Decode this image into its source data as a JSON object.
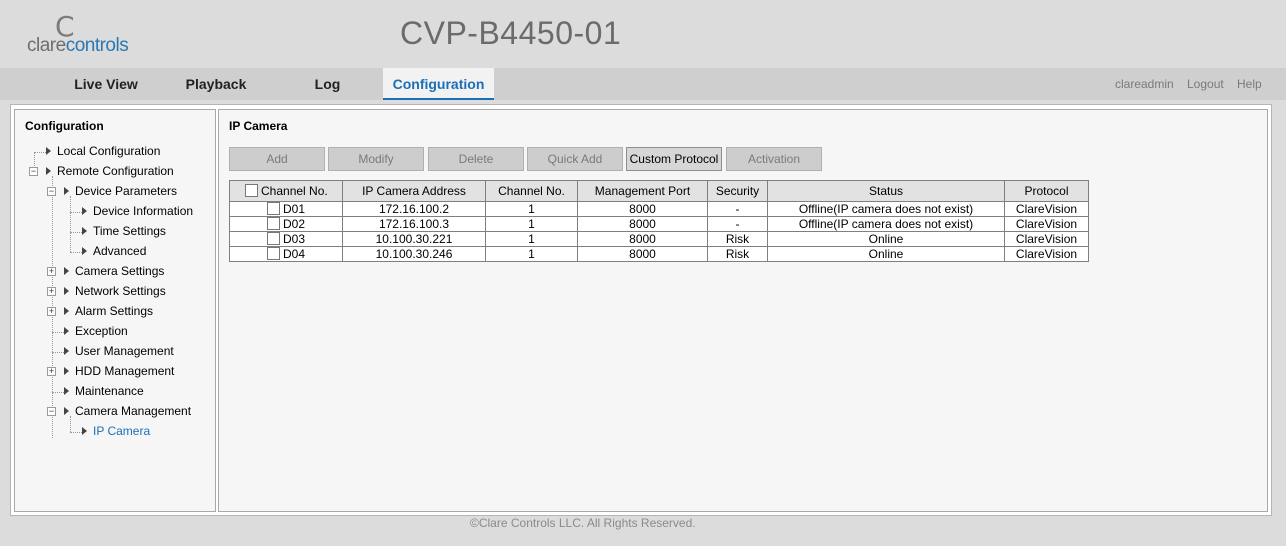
{
  "header": {
    "brand_clare": "clare",
    "brand_controls": "controls",
    "device_name": "CVP-B4450-01"
  },
  "nav": {
    "tabs": [
      "Live View",
      "Playback",
      "Log",
      "Configuration"
    ],
    "active_tab": "Configuration"
  },
  "user": {
    "username": "clareadmin",
    "logout": "Logout",
    "help": "Help"
  },
  "sidebar": {
    "title": "Configuration",
    "items": {
      "local_configuration": "Local Configuration",
      "remote_configuration": "Remote Configuration",
      "device_parameters": "Device Parameters",
      "device_information": "Device Information",
      "time_settings": "Time Settings",
      "advanced": "Advanced",
      "camera_settings": "Camera Settings",
      "network_settings": "Network Settings",
      "alarm_settings": "Alarm Settings",
      "exception": "Exception",
      "user_management": "User Management",
      "hdd_management": "HDD Management",
      "maintenance": "Maintenance",
      "camera_management": "Camera Management",
      "ip_camera": "IP Camera"
    },
    "selected": "IP Camera"
  },
  "content": {
    "title": "IP Camera",
    "buttons": {
      "add": "Add",
      "modify": "Modify",
      "delete": "Delete",
      "quick_add": "Quick Add",
      "custom_protocol": "Custom Protocol",
      "activation": "Activation"
    },
    "table": {
      "headers": [
        "Channel No.",
        "IP Camera Address",
        "Channel No.",
        "Management Port",
        "Security",
        "Status",
        "Protocol"
      ],
      "rows": [
        [
          "D01",
          "172.16.100.2",
          "1",
          "8000",
          "-",
          "Offline(IP camera does not exist)",
          "ClareVision"
        ],
        [
          "D02",
          "172.16.100.3",
          "1",
          "8000",
          "-",
          "Offline(IP camera does not exist)",
          "ClareVision"
        ],
        [
          "D03",
          "10.100.30.221",
          "1",
          "8000",
          "Risk",
          "Online",
          "ClareVision"
        ],
        [
          "D04",
          "10.100.30.246",
          "1",
          "8000",
          "Risk",
          "Online",
          "ClareVision"
        ]
      ]
    }
  },
  "footer": {
    "copyright": "©Clare Controls LLC. All Rights Reserved."
  }
}
